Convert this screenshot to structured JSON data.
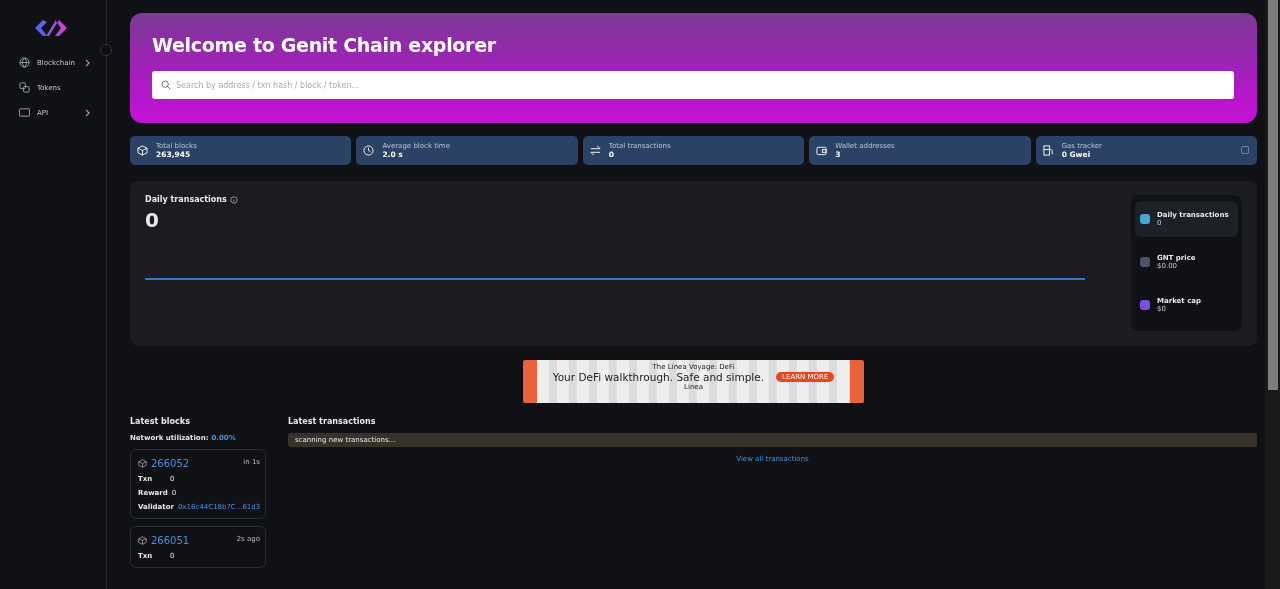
{
  "sidebar": {
    "items": [
      {
        "label": "Blockchain",
        "has_submenu": true
      },
      {
        "label": "Tokens",
        "has_submenu": false
      },
      {
        "label": "API",
        "has_submenu": true
      }
    ]
  },
  "hero": {
    "title": "Welcome to Genit Chain explorer",
    "search": {
      "placeholder": "Search by address / txn hash / block / token..."
    }
  },
  "stats": [
    {
      "label": "Total blocks",
      "value": "263,945"
    },
    {
      "label": "Average block time",
      "value": "2.0 s"
    },
    {
      "label": "Total transactions",
      "value": "0"
    },
    {
      "label": "Wallet addresses",
      "value": "3"
    },
    {
      "label": "Gas tracker",
      "value": "0 Gwei"
    }
  ],
  "daily": {
    "title": "Daily transactions",
    "value": "0",
    "side": [
      {
        "label": "Daily transactions",
        "value": "0",
        "selected": true,
        "color": "#3fa9d6"
      },
      {
        "label": "GNT price",
        "value": "$0.00",
        "selected": false,
        "color": "#4a5468"
      },
      {
        "label": "Market cap",
        "value": "$0",
        "selected": false,
        "color": "#7b4fe0"
      }
    ]
  },
  "banner": {
    "kicker": "The Linea Voyage: DeFi",
    "headline": "Your DeFi walkthrough. Safe and simple.",
    "button": "LEARN MORE",
    "brand": "Linea"
  },
  "latest_blocks": {
    "title": "Latest blocks",
    "utilization_label": "Network utilization:",
    "utilization_value": "0.00%",
    "blocks": [
      {
        "number": "266052",
        "age": "in 1s",
        "rows": [
          {
            "label": "Txn",
            "value": "0",
            "kind": "plain"
          },
          {
            "label": "Reward",
            "value": "0",
            "kind": "plain"
          },
          {
            "label": "Validator",
            "value": "0x16c44C18b7C...61d3",
            "kind": "link"
          }
        ]
      },
      {
        "number": "266051",
        "age": "2s ago",
        "rows": [
          {
            "label": "Txn",
            "value": "0",
            "kind": "plain"
          }
        ]
      }
    ]
  },
  "latest_transactions": {
    "title": "Latest transactions",
    "notice": "scanning new transactions...",
    "link": "View all transactions"
  }
}
